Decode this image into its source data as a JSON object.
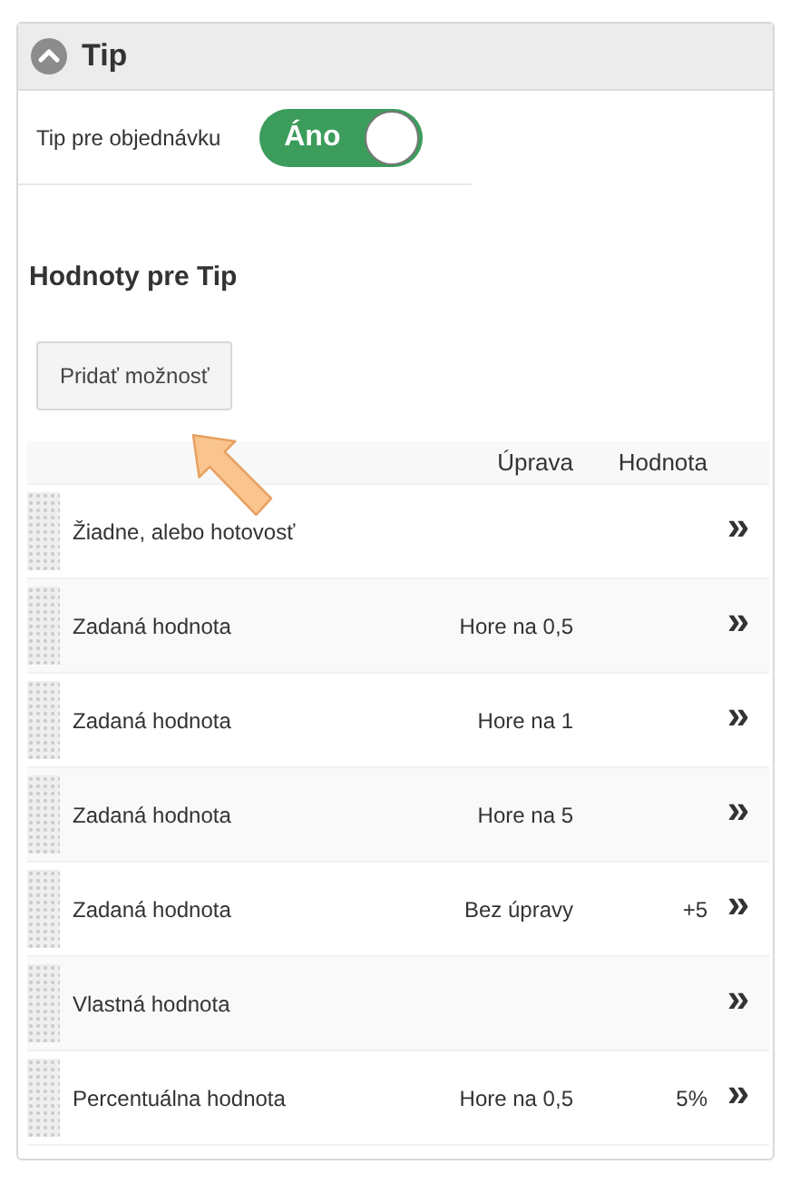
{
  "panel": {
    "title": "Tip",
    "expanded": true
  },
  "tip_setting": {
    "label": "Tip pre objednávku",
    "toggle": {
      "on": true,
      "label": "Áno"
    }
  },
  "section_title": "Hodnoty pre Tip",
  "add_button": "Pridať možnosť",
  "table": {
    "columns": [
      "Úprava",
      "Hodnota"
    ],
    "rows": [
      {
        "name": "Žiadne, alebo hotovosť",
        "adjustment": "",
        "value": "",
        "action": "»"
      },
      {
        "name": "Zadaná hodnota",
        "adjustment": "Hore na 0,5",
        "value": "",
        "action": "»"
      },
      {
        "name": "Zadaná hodnota",
        "adjustment": "Hore na 1",
        "value": "",
        "action": "»"
      },
      {
        "name": "Zadaná hodnota",
        "adjustment": "Hore na 5",
        "value": "",
        "action": "»"
      },
      {
        "name": "Zadaná hodnota",
        "adjustment": "Bez úpravy",
        "value": "+5",
        "action": "»"
      },
      {
        "name": "Vlastná hodnota",
        "adjustment": "",
        "value": "",
        "action": "»"
      },
      {
        "name": "Percentuálna hodnota",
        "adjustment": "Hore na 0,5",
        "value": "5%",
        "action": "»"
      }
    ]
  }
}
